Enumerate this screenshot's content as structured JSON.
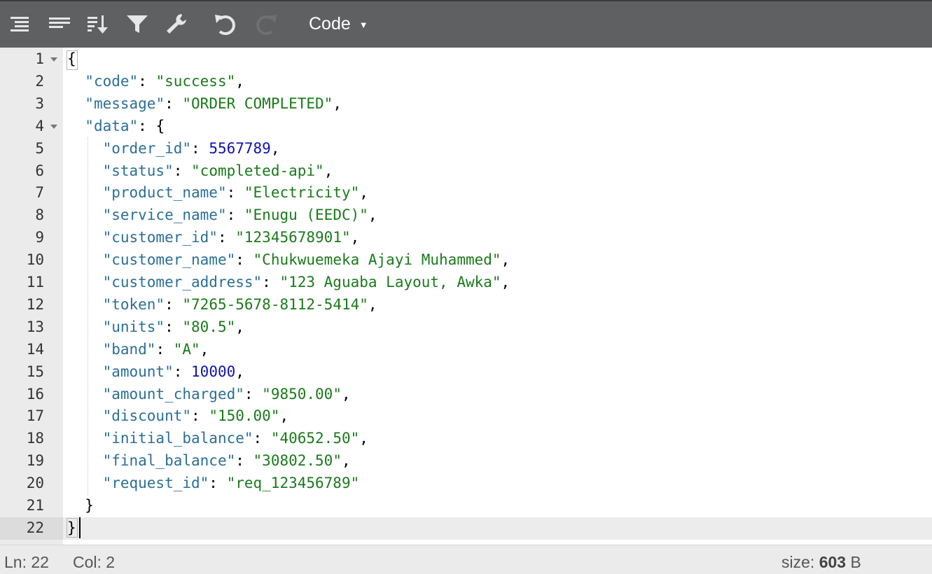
{
  "toolbar": {
    "buttons": [
      {
        "name": "format-icon"
      },
      {
        "name": "compact-icon"
      },
      {
        "name": "sort-icon"
      },
      {
        "name": "filter-icon"
      },
      {
        "name": "repair-icon"
      },
      {
        "name": "undo-icon"
      },
      {
        "name": "redo-icon"
      }
    ],
    "mode_label": "Code"
  },
  "editor": {
    "lines": [
      {
        "n": "1",
        "tokens": [
          [
            "p",
            "{"
          ]
        ],
        "fold": true
      },
      {
        "n": "2",
        "tokens": [
          [
            "p",
            "  "
          ],
          [
            "k",
            "\"code\""
          ],
          [
            "p",
            ": "
          ],
          [
            "s",
            "\"success\""
          ],
          [
            "p",
            ","
          ]
        ]
      },
      {
        "n": "3",
        "tokens": [
          [
            "p",
            "  "
          ],
          [
            "k",
            "\"message\""
          ],
          [
            "p",
            ": "
          ],
          [
            "s",
            "\"ORDER COMPLETED\""
          ],
          [
            "p",
            ","
          ]
        ]
      },
      {
        "n": "4",
        "tokens": [
          [
            "p",
            "  "
          ],
          [
            "k",
            "\"data\""
          ],
          [
            "p",
            ": {"
          ]
        ],
        "fold": true
      },
      {
        "n": "5",
        "tokens": [
          [
            "p",
            "    "
          ],
          [
            "k",
            "\"order_id\""
          ],
          [
            "p",
            ": "
          ],
          [
            "n",
            "5567789"
          ],
          [
            "p",
            ","
          ]
        ]
      },
      {
        "n": "6",
        "tokens": [
          [
            "p",
            "    "
          ],
          [
            "k",
            "\"status\""
          ],
          [
            "p",
            ": "
          ],
          [
            "s",
            "\"completed-api\""
          ],
          [
            "p",
            ","
          ]
        ]
      },
      {
        "n": "7",
        "tokens": [
          [
            "p",
            "    "
          ],
          [
            "k",
            "\"product_name\""
          ],
          [
            "p",
            ": "
          ],
          [
            "s",
            "\"Electricity\""
          ],
          [
            "p",
            ","
          ]
        ]
      },
      {
        "n": "8",
        "tokens": [
          [
            "p",
            "    "
          ],
          [
            "k",
            "\"service_name\""
          ],
          [
            "p",
            ": "
          ],
          [
            "s",
            "\"Enugu (EEDC)\""
          ],
          [
            "p",
            ","
          ]
        ]
      },
      {
        "n": "9",
        "tokens": [
          [
            "p",
            "    "
          ],
          [
            "k",
            "\"customer_id\""
          ],
          [
            "p",
            ": "
          ],
          [
            "s",
            "\"12345678901\""
          ],
          [
            "p",
            ","
          ]
        ]
      },
      {
        "n": "10",
        "tokens": [
          [
            "p",
            "    "
          ],
          [
            "k",
            "\"customer_name\""
          ],
          [
            "p",
            ": "
          ],
          [
            "s",
            "\"Chukwuemeka Ajayi Muhammed\""
          ],
          [
            "p",
            ","
          ]
        ]
      },
      {
        "n": "11",
        "tokens": [
          [
            "p",
            "    "
          ],
          [
            "k",
            "\"customer_address\""
          ],
          [
            "p",
            ": "
          ],
          [
            "s",
            "\"123 Aguaba Layout, Awka\""
          ],
          [
            "p",
            ","
          ]
        ]
      },
      {
        "n": "12",
        "tokens": [
          [
            "p",
            "    "
          ],
          [
            "k",
            "\"token\""
          ],
          [
            "p",
            ": "
          ],
          [
            "s",
            "\"7265-5678-8112-5414\""
          ],
          [
            "p",
            ","
          ]
        ]
      },
      {
        "n": "13",
        "tokens": [
          [
            "p",
            "    "
          ],
          [
            "k",
            "\"units\""
          ],
          [
            "p",
            ": "
          ],
          [
            "s",
            "\"80.5\""
          ],
          [
            "p",
            ","
          ]
        ]
      },
      {
        "n": "14",
        "tokens": [
          [
            "p",
            "    "
          ],
          [
            "k",
            "\"band\""
          ],
          [
            "p",
            ": "
          ],
          [
            "s",
            "\"A\""
          ],
          [
            "p",
            ","
          ]
        ]
      },
      {
        "n": "15",
        "tokens": [
          [
            "p",
            "    "
          ],
          [
            "k",
            "\"amount\""
          ],
          [
            "p",
            ": "
          ],
          [
            "n",
            "10000"
          ],
          [
            "p",
            ","
          ]
        ]
      },
      {
        "n": "16",
        "tokens": [
          [
            "p",
            "    "
          ],
          [
            "k",
            "\"amount_charged\""
          ],
          [
            "p",
            ": "
          ],
          [
            "s",
            "\"9850.00\""
          ],
          [
            "p",
            ","
          ]
        ]
      },
      {
        "n": "17",
        "tokens": [
          [
            "p",
            "    "
          ],
          [
            "k",
            "\"discount\""
          ],
          [
            "p",
            ": "
          ],
          [
            "s",
            "\"150.00\""
          ],
          [
            "p",
            ","
          ]
        ]
      },
      {
        "n": "18",
        "tokens": [
          [
            "p",
            "    "
          ],
          [
            "k",
            "\"initial_balance\""
          ],
          [
            "p",
            ": "
          ],
          [
            "s",
            "\"40652.50\""
          ],
          [
            "p",
            ","
          ]
        ]
      },
      {
        "n": "19",
        "tokens": [
          [
            "p",
            "    "
          ],
          [
            "k",
            "\"final_balance\""
          ],
          [
            "p",
            ": "
          ],
          [
            "s",
            "\"30802.50\""
          ],
          [
            "p",
            ","
          ]
        ]
      },
      {
        "n": "20",
        "tokens": [
          [
            "p",
            "    "
          ],
          [
            "k",
            "\"request_id\""
          ],
          [
            "p",
            ": "
          ],
          [
            "s",
            "\"req_123456789\""
          ]
        ]
      },
      {
        "n": "21",
        "tokens": [
          [
            "p",
            "  }"
          ]
        ]
      },
      {
        "n": "22",
        "tokens": [
          [
            "p",
            "}"
          ]
        ],
        "active": true
      }
    ]
  },
  "status": {
    "ln_label": "Ln:",
    "ln_value": "22",
    "col_label": "Col:",
    "col_value": "2",
    "size_label": "size:",
    "size_value": "603",
    "size_unit": "B"
  },
  "colors": {
    "toolbar_bg": "#5f6062",
    "key": "#2b6f96",
    "string": "#1a7a1a",
    "number": "#1010b8"
  }
}
